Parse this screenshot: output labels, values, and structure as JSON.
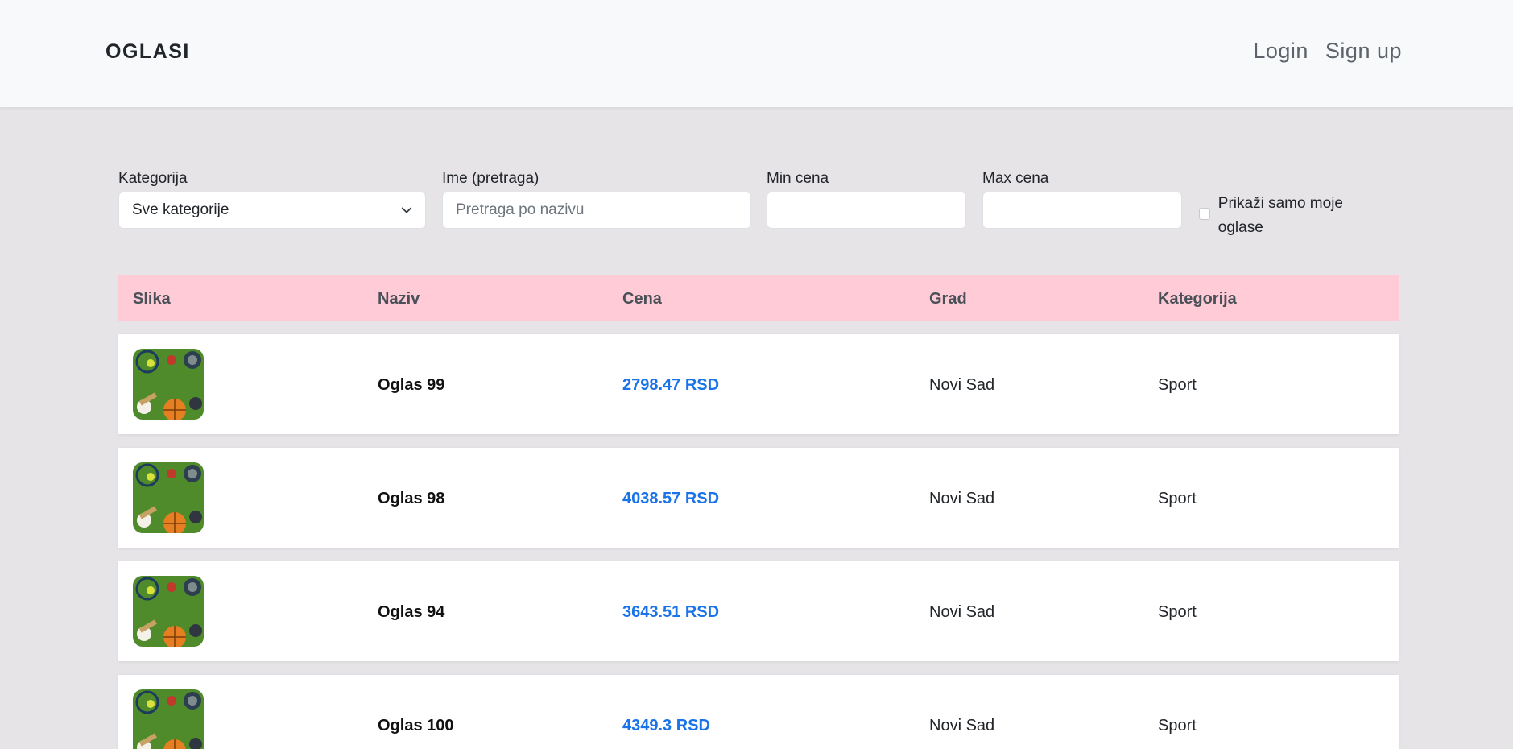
{
  "navbar": {
    "brand": "OGLASI",
    "links": [
      "Login",
      "Sign up"
    ]
  },
  "filters": {
    "category": {
      "label": "Kategorija",
      "value": "Sve kategorije"
    },
    "name": {
      "label": "Ime (pretraga)",
      "placeholder": "Pretraga po nazivu",
      "value": ""
    },
    "min_price": {
      "label": "Min cena",
      "value": ""
    },
    "max_price": {
      "label": "Max cena",
      "value": ""
    },
    "only_mine": {
      "label": "Prikaži samo moje oglase",
      "checked": false
    }
  },
  "table": {
    "headers": [
      "Slika",
      "Naziv",
      "Cena",
      "Grad",
      "Kategorija"
    ],
    "rows": [
      {
        "name": "Oglas 99",
        "price": "2798.47 RSD",
        "city": "Novi Sad",
        "category": "Sport"
      },
      {
        "name": "Oglas 98",
        "price": "4038.57 RSD",
        "city": "Novi Sad",
        "category": "Sport"
      },
      {
        "name": "Oglas 94",
        "price": "3643.51 RSD",
        "city": "Novi Sad",
        "category": "Sport"
      },
      {
        "name": "Oglas 100",
        "price": "4349.3 RSD",
        "city": "Novi Sad",
        "category": "Sport"
      }
    ]
  },
  "colors": {
    "header_row": "#fecbd6",
    "price": "#1a73e8",
    "background": "#e6e4e7"
  }
}
